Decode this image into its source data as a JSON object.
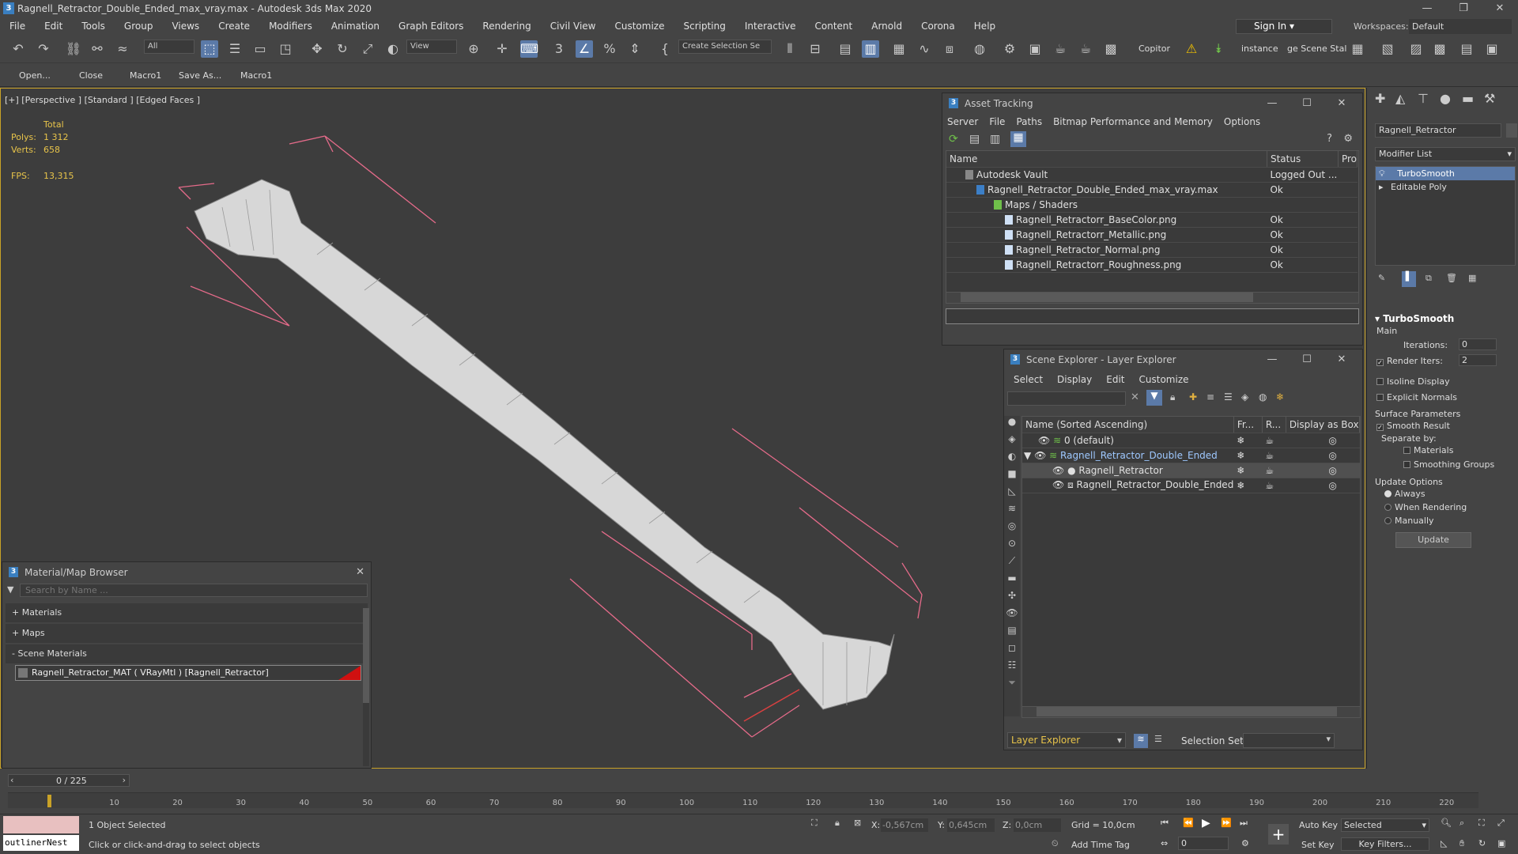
{
  "window": {
    "title": "Ragnell_Retractor_Double_Ended_max_vray.max - Autodesk 3ds Max 2020",
    "app_icon": "3"
  },
  "menu": [
    "File",
    "Edit",
    "Tools",
    "Group",
    "Views",
    "Create",
    "Modifiers",
    "Animation",
    "Graph Editors",
    "Rendering",
    "Civil View",
    "Customize",
    "Scripting",
    "Interactive",
    "Content",
    "Arnold",
    "Corona",
    "Help"
  ],
  "signin": "Sign In",
  "workspaces": {
    "label": "Workspaces:",
    "value": "Default"
  },
  "toolbar": {
    "filter": "All",
    "view": "View",
    "selection_set": "Create Selection Se",
    "copitor": "Copitor",
    "instance": "instance",
    "scene_stat": "ge Scene Stal"
  },
  "macros": [
    "Open...",
    "Close",
    "Macro1",
    "Save As...",
    "Macro1"
  ],
  "viewport": {
    "label": "[+] [Perspective ] [Standard ] [Edged Faces ]",
    "stats": {
      "total": "Total",
      "polys_label": "Polys:",
      "polys": "1 312",
      "verts_label": "Verts:",
      "verts": "658",
      "fps_label": "FPS:",
      "fps": "13,315"
    }
  },
  "asset_tracking": {
    "title": "Asset Tracking",
    "menu": [
      "Server",
      "File",
      "Paths",
      "Bitmap Performance and Memory",
      "Options"
    ],
    "columns": [
      "Name",
      "Status",
      "Pro"
    ],
    "rows": [
      {
        "name": "Autodesk Vault",
        "status": "Logged Out ..."
      },
      {
        "name": "Ragnell_Retractor_Double_Ended_max_vray.max",
        "status": "Ok"
      },
      {
        "name": "Maps / Shaders",
        "status": ""
      },
      {
        "name": "Ragnell_Retractorr_BaseColor.png",
        "status": "Ok"
      },
      {
        "name": "Ragnell_Retractorr_Metallic.png",
        "status": "Ok"
      },
      {
        "name": "Ragnell_Retractor_Normal.png",
        "status": "Ok"
      },
      {
        "name": "Ragnell_Retractorr_Roughness.png",
        "status": "Ok"
      }
    ]
  },
  "scene_explorer": {
    "title": "Scene Explorer - Layer Explorer",
    "menu": [
      "Select",
      "Display",
      "Edit",
      "Customize"
    ],
    "columns": [
      "Name (Sorted Ascending)",
      "Fr...",
      "R...",
      "Display as Box"
    ],
    "rows": [
      {
        "name": "0 (default)"
      },
      {
        "name": "Ragnell_Retractor_Double_Ended"
      },
      {
        "name": "Ragnell_Retractor"
      },
      {
        "name": "Ragnell_Retractor_Double_Ended"
      }
    ],
    "footer_dropdown": "Layer Explorer",
    "selection_set_label": "Selection Set:"
  },
  "material_browser": {
    "title": "Material/Map Browser",
    "search_placeholder": "Search by Name ...",
    "groups": [
      "+ Materials",
      "+ Maps",
      "- Scene Materials"
    ],
    "item": "Ragnell_Retractor_MAT  ( VRayMtl )  [Ragnell_Retractor]"
  },
  "command_panel": {
    "object_name": "Ragnell_Retractor",
    "modifier_list": "Modifier List",
    "stack": [
      "TurboSmooth",
      "Editable Poly"
    ],
    "rollout": "TurboSmooth",
    "main": "Main",
    "iterations_label": "Iterations:",
    "iterations": "0",
    "render_iters_label": "Render Iters:",
    "render_iters": "2",
    "isoline": "Isoline Display",
    "explicit_normals": "Explicit Normals",
    "surface_params": "Surface Parameters",
    "smooth_result": "Smooth Result",
    "separate_by": "Separate by:",
    "materials": "Materials",
    "smoothing_groups": "Smoothing Groups",
    "update_options": "Update Options",
    "always": "Always",
    "when_rendering": "When Rendering",
    "manually": "Manually",
    "update": "Update"
  },
  "timeline": {
    "frame": "0 / 225",
    "ticks": [
      "10",
      "20",
      "30",
      "40",
      "50",
      "60",
      "70",
      "80",
      "90",
      "100",
      "110",
      "120",
      "130",
      "140",
      "150",
      "160",
      "170",
      "180",
      "190",
      "200",
      "210",
      "220"
    ]
  },
  "status": {
    "script_box": "outlinerNest",
    "selected": "1 Object Selected",
    "prompt": "Click or click-and-drag to select objects",
    "x_label": "X:",
    "x": "-0,567cm",
    "y_label": "Y:",
    "y": "0,645cm",
    "z_label": "Z:",
    "z": "0,0cm",
    "grid": "Grid = 10,0cm",
    "add_time_tag": "Add Time Tag",
    "auto_key": "Auto Key",
    "selected_dd": "Selected",
    "set_key": "Set Key",
    "key_filters": "Key Filters...",
    "frame_field": "0"
  }
}
